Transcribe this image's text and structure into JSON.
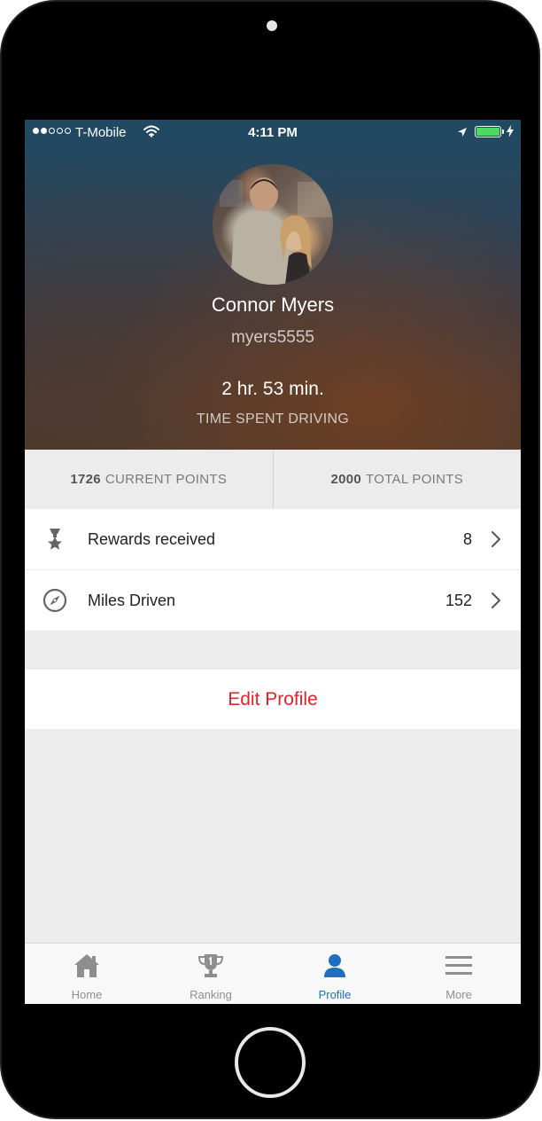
{
  "status_bar": {
    "signal_dots_filled": 2,
    "signal_dots_total": 5,
    "carrier": "T-Mobile",
    "time": "4:11 PM",
    "battery_level": 1.0,
    "battery_color": "#4cd964",
    "icons": [
      "wifi-icon",
      "location-arrow-icon",
      "battery-icon",
      "charging-bolt-icon"
    ]
  },
  "profile": {
    "name": "Connor Myers",
    "username": "myers5555",
    "drive_time": "2 hr. 53 min.",
    "drive_time_label": "TIME SPENT DRIVING"
  },
  "points": {
    "current": {
      "value": "1726",
      "label": "CURRENT POINTS"
    },
    "total": {
      "value": "2000",
      "label": "TOTAL POINTS"
    }
  },
  "stats": [
    {
      "icon": "medal-icon",
      "label": "Rewards received",
      "value": "8"
    },
    {
      "icon": "compass-icon",
      "label": "Miles Driven",
      "value": "152"
    }
  ],
  "edit_profile": {
    "label": "Edit Profile",
    "color": "#e5202a"
  },
  "tabs": [
    {
      "icon": "home-icon",
      "label": "Home",
      "active": false
    },
    {
      "icon": "trophy-icon",
      "label": "Ranking",
      "active": false
    },
    {
      "icon": "person-icon",
      "label": "Profile",
      "active": true
    },
    {
      "icon": "menu-icon",
      "label": "More",
      "active": false
    }
  ],
  "colors": {
    "accent": "#1e6fc0",
    "inactive_tab": "#8e8e8e",
    "background": "#ececec"
  }
}
